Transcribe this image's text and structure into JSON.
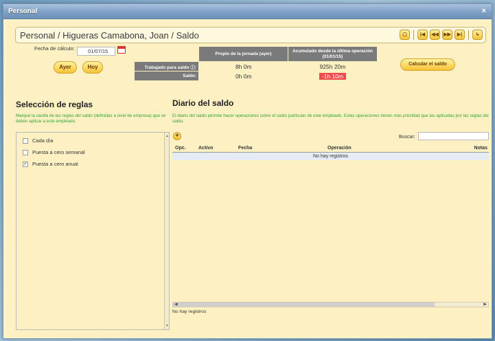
{
  "window": {
    "title": "Personal",
    "close_glyph": "×"
  },
  "path": "Personal / Higueras Camabona, Joan / Saldo",
  "nav": {
    "icons": [
      "document-icon",
      "first-icon",
      "prev-icon",
      "next-icon",
      "last-icon",
      "exit-icon"
    ],
    "glyphs": [
      "▢",
      "|◀",
      "◀◀",
      "▶▶",
      "▶|",
      "↳"
    ]
  },
  "date": {
    "label": "Fecha de cálculo:",
    "value": "01/07/15"
  },
  "buttons": {
    "ayer": "Ayer",
    "hoy": "Hoy",
    "calcular": "Calcular el saldo"
  },
  "summary": {
    "col1_header": "Propio de la jornada (ayer)",
    "col2_header": "Acumulado desde la última operación (01/01/15)",
    "row1_label": "Trabajado para saldo ⓘ:",
    "row1_col1": "8h 0m",
    "row1_col2": "925h 20m",
    "row2_label": "Saldo:",
    "row2_col1": "0h 0m",
    "row2_col2": "-1h 10m"
  },
  "rules": {
    "title": "Selección de reglas",
    "desc": "Marque la casilla de las reglas del saldo (definidas a nivel de empresa) que se deben aplicar a este empleado.",
    "items": [
      {
        "label": "Cada día",
        "checked": false
      },
      {
        "label": "Puesta a cero semanal",
        "checked": false
      },
      {
        "label": "Puesta a cero anual",
        "checked": true
      }
    ]
  },
  "diario": {
    "title": "Diario del saldo",
    "desc": "El diario del saldo permite hacer operaciones sobre el saldo particular de este empleado. Estas operaciones tienen más prioridad que las aplicadas por las reglas del saldo.",
    "search_label": "Buscar:",
    "search_value": "",
    "columns": [
      "Opc.",
      "Activo",
      "Fecha",
      "Operación",
      "Notas"
    ],
    "empty": "No hay registros",
    "footer": "No hay registros"
  }
}
